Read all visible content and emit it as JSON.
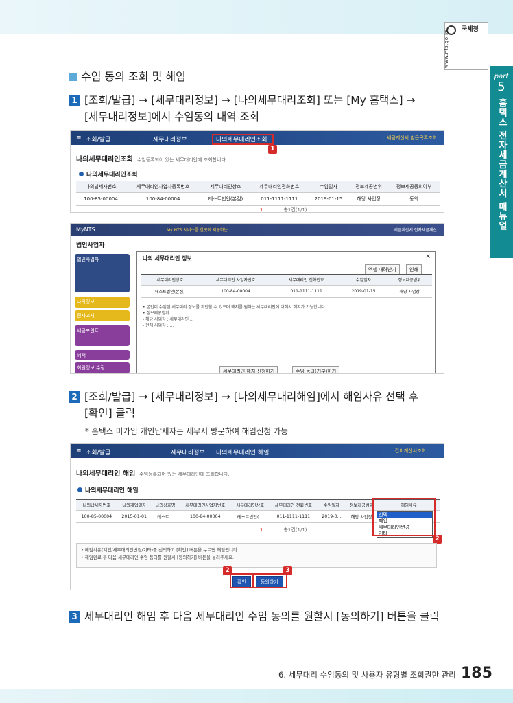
{
  "brand": {
    "name": "국세청",
    "url": "www.nts.go.kr"
  },
  "side_tab": {
    "part": "part",
    "number": "5",
    "title": "홈택스 전자세금계산서 매뉴얼"
  },
  "section_title": "수임 동의 조회 및 해임",
  "steps": [
    {
      "num": "1",
      "line1": "[조회/발급] → [세무대리정보] → [나의세무대리조회] 또는 [My 홈택스] →",
      "line2": "[세무대리정보]에서 수임동의 내역 조회"
    },
    {
      "num": "2",
      "line1": "[조회/발급] → [세무대리정보] → [나의세무대리해임]에서 해임사유 선택 후",
      "line2": "[확인] 클릭"
    },
    {
      "num": "3",
      "line1": "세무대리인 해임 후 다음 세무대리인 수임 동의를 원할시 [동의하기] 버튼을 클릭"
    }
  ],
  "note": "* 홈택스 미가입 개인납세자는 세무서 방문하여 해임신청 가능",
  "shot1": {
    "nav": [
      "조회/발급",
      "세무대리정보",
      "나의세무대리인조회"
    ],
    "nav_right": "세금계산서 발급목록조회",
    "title": "나의세무대리인조회",
    "subtitle": "수임등록되어 있는 세무대리인에 조회합니다.",
    "section": "나의세무대리인조회",
    "headers": [
      "나의납세자번호",
      "세무대리인사업자등록번호",
      "세무대리인상호",
      "세무대리인전화번호",
      "수임일자",
      "정보제공범위",
      "정보제공동의여부"
    ],
    "row": [
      "100-85-00004",
      "100-84-00004",
      "테스트법인(본점)",
      "011-1111-1111",
      "2019-01-15",
      "해당 사업장",
      "동의"
    ],
    "pager_current": "1",
    "pager_info": "총1건(1/1)",
    "callout_num": "1"
  },
  "shot2": {
    "top_brand": "MyNTS",
    "top_notice": "My NTS 서비스를 한곳에 제공하는 ...",
    "top_right": "세금계산서 전자세금계산",
    "left_header": "법인사업자",
    "cards": [
      "법인사업자",
      "나의정보",
      "전자고지",
      "세금포인트",
      "혜택",
      "회원정보 수정"
    ],
    "modal_title": "나의 세무대리인 정보",
    "modal_buttons": [
      "엑셀 내려받기",
      "인쇄"
    ],
    "modal_headers": [
      "세무대리인상호",
      "세무대리인 사업자번호",
      "세무대리인 전화번호",
      "수임일자",
      "정보제공범위"
    ],
    "modal_row": [
      "테스트법인(본점)",
      "100-84-00004",
      "011-1111-1111",
      "2019-01-15",
      "해당 사업장"
    ],
    "modal_notes": [
      "• 본인이 수임된 세무대리 정보를 확인할 수 있으며 해지를 원하는 세무대리인에 대해서 해지가 가능합니다.",
      "• 정보제공범위",
      " - 해당 사업장 : 세무대리인 ...",
      " - 전체 사업장 : ..."
    ],
    "modal_actions": [
      "세무대리인 해지 신청하기",
      "수임 동의(거부)하기"
    ]
  },
  "shot3": {
    "nav": [
      "조회/발급",
      "세무대리정보",
      "나의세무대리인 해임"
    ],
    "nav_right": "간이계산서조회",
    "title": "나의세무대리인 해임",
    "subtitle": "수임등록되어 있는 세무대리인에 조회합니다.",
    "section": "나의세무대리인 해임",
    "headers": [
      "나의납세자번호",
      "나의개업일자",
      "나의상호명",
      "세무대리인사업자번호",
      "세무대리인상호",
      "세무대리인 전화번호",
      "수임일자",
      "정보제공범위",
      "해임사유"
    ],
    "row": [
      "100-85-00004",
      "2015-01-01",
      "테스트...",
      "100-84-00004",
      "테스트법인(...",
      "011-1111-1111",
      "2019-0...",
      "해당 사업장"
    ],
    "reasons": [
      "선택",
      "폐업",
      "세무대리인변경",
      "기타"
    ],
    "pager_current": "1",
    "pager_info": "총1건(1/1)",
    "notes": [
      "• 해임사유(폐업/세무대리인변경/기타)를 선택하고 [확인] 버튼을 누르면 해임됩니다.",
      "• 해임완료 후 다음 세무대리인 수임 동의를 원할시 [동의하기] 버튼을 눌러주세요."
    ],
    "btn_confirm": "확인",
    "btn_agree": "동의하기",
    "callouts": [
      "2",
      "2",
      "3"
    ]
  },
  "footer": "6. 세무대리 수임동의 및 사용자 유형별 조회권한 관리",
  "page_number": "185"
}
